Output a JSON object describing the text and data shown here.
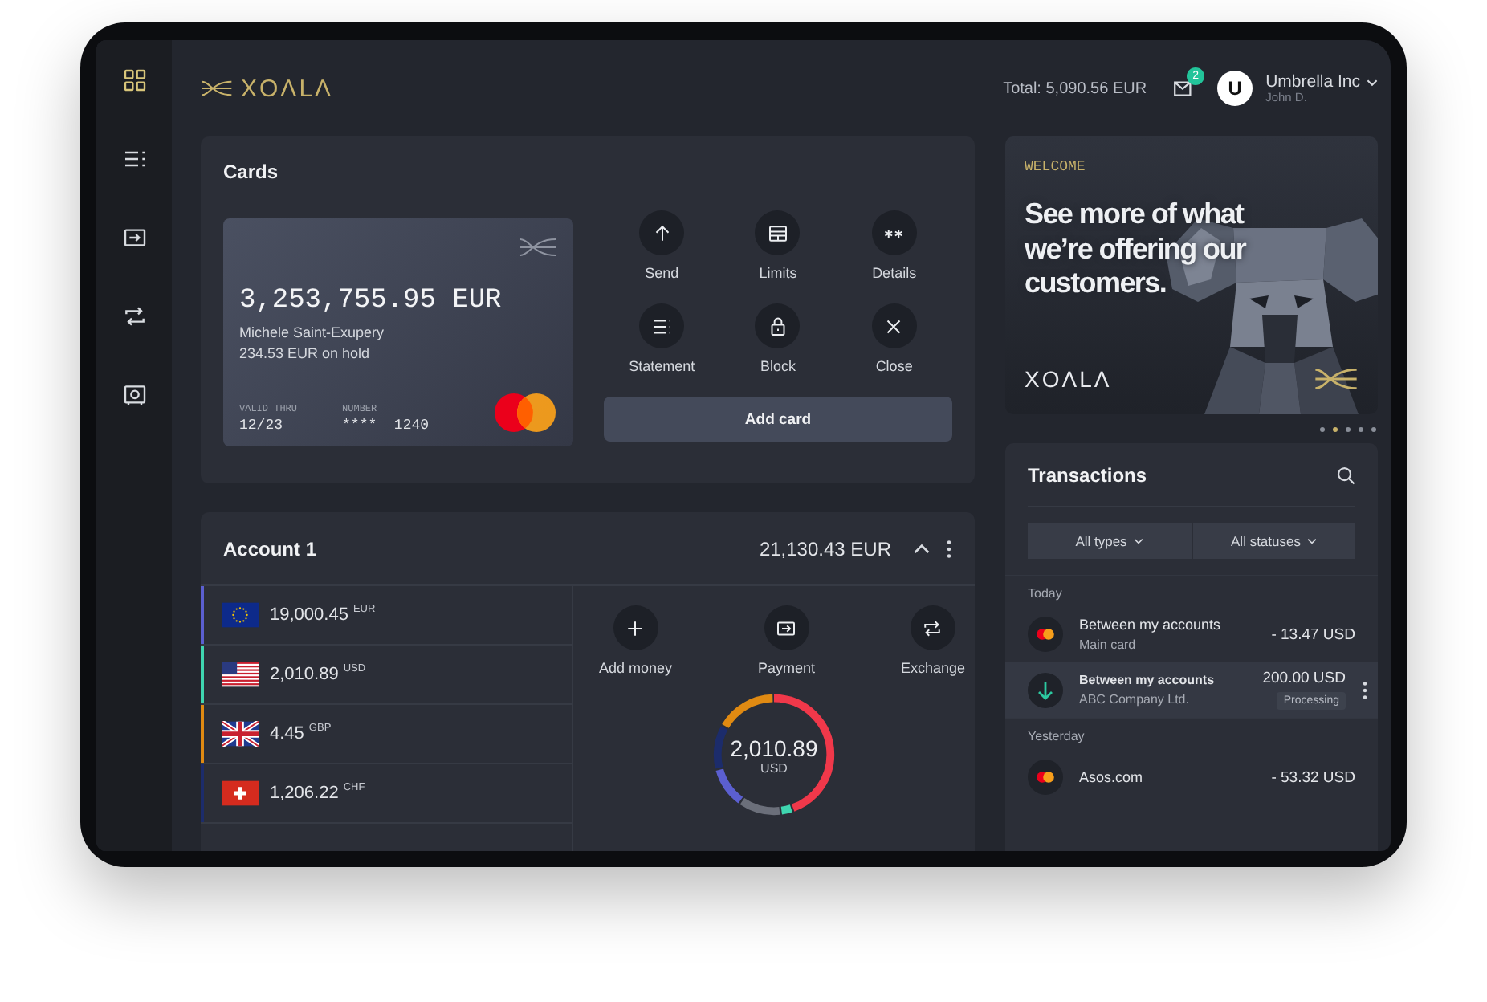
{
  "sidebar": {
    "items": [
      {
        "kind": "grid",
        "selected": true
      },
      {
        "kind": "list",
        "selected": false
      },
      {
        "kind": "payment",
        "selected": false
      },
      {
        "kind": "exchange",
        "selected": false
      },
      {
        "kind": "safe",
        "selected": false
      }
    ]
  },
  "header": {
    "logo": "XOΛLΛ",
    "total": "Total: 5,090.56 EUR",
    "mail_badge": "2",
    "avatar": "U",
    "company": "Umbrella Inc",
    "user": "John D."
  },
  "cards": {
    "title": "Cards",
    "card": {
      "balance": "3,253,755.95 EUR",
      "holder": "Michele Saint-Exupery",
      "hold": "234.53 EUR on hold",
      "valid_label": "VALID THRU",
      "valid": "12/23",
      "number_label": "NUMBER",
      "number": "****  1240"
    },
    "actions": [
      {
        "kind": "send",
        "label": "Send"
      },
      {
        "kind": "limits",
        "label": "Limits"
      },
      {
        "kind": "details",
        "label": "Details"
      },
      {
        "kind": "statement",
        "label": "Statement"
      },
      {
        "kind": "block",
        "label": "Block"
      },
      {
        "kind": "close",
        "label": "Close"
      }
    ],
    "add_button": "Add card"
  },
  "account": {
    "title": "Account 1",
    "total": "21,130.43 EUR",
    "expanded": true,
    "balances": [
      {
        "kind": "eu",
        "amount": "19,000.45",
        "currency": "EUR",
        "color": "#5b5fd0"
      },
      {
        "kind": "us",
        "amount": "2,010.89",
        "currency": "USD",
        "color": "#3fd6b0"
      },
      {
        "kind": "gb",
        "amount": "4.45",
        "currency": "GBP",
        "color": "#e08a12"
      },
      {
        "kind": "ch",
        "amount": "1,206.22",
        "currency": "CHF",
        "color": "#1c2c6b"
      }
    ],
    "actions": [
      {
        "kind": "add",
        "label": "Add money"
      },
      {
        "kind": "payment",
        "label": "Payment"
      },
      {
        "kind": "exchange",
        "label": "Exchange"
      }
    ],
    "donut": {
      "amount": "2,010.89",
      "currency": "USD"
    }
  },
  "banner": {
    "eyebrow": "WELCOME",
    "headline": "See more of what we’re offering our customers.",
    "logo": "XOΛLΛ",
    "dots": [
      {
        "selected": false
      },
      {
        "selected": true
      },
      {
        "selected": false
      },
      {
        "selected": false
      },
      {
        "selected": false
      }
    ]
  },
  "transactions": {
    "title": "Transactions",
    "filters": [
      "All types",
      "All statuses"
    ],
    "groups": [
      {
        "label": "Today",
        "items": [
          {
            "kind": "card",
            "title": "Between my accounts",
            "subtitle": "Main card",
            "amount": "- 13.47 USD",
            "selected": false
          },
          {
            "kind": "incoming",
            "title": "Between my accounts",
            "subtitle": "ABC Company Ltd.",
            "amount": "200.00 USD",
            "status": "Processing",
            "selected": true
          }
        ]
      },
      {
        "label": "Yesterday",
        "items": [
          {
            "kind": "card",
            "title": "Asos.com",
            "amount": "- 53.32 USD",
            "selected": false
          }
        ]
      }
    ]
  }
}
